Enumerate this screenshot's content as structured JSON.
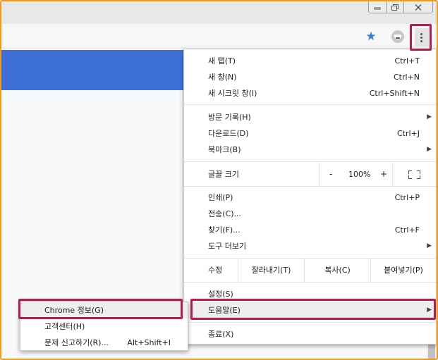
{
  "window": {
    "minimize_icon": "minimize-icon",
    "maximize_icon": "restore-icon",
    "close_icon": "close-icon"
  },
  "toolbar": {
    "bookmark_icon": "star-icon",
    "extension_icon": "extension-icon",
    "menu_icon": "kebab-menu-icon",
    "star_color": "#3b78e7"
  },
  "page": {
    "banner_color": "#3d6fd6"
  },
  "menu": {
    "new_tab": {
      "label": "새 탭(T)",
      "shortcut": "Ctrl+T"
    },
    "new_window": {
      "label": "새 창(N)",
      "shortcut": "Ctrl+N"
    },
    "incognito": {
      "label": "새 시크릿 창(I)",
      "shortcut": "Ctrl+Shift+N"
    },
    "history": {
      "label": "방문 기록(H)"
    },
    "downloads": {
      "label": "다운로드(D)",
      "shortcut": "Ctrl+J"
    },
    "bookmarks": {
      "label": "북마크(B)"
    },
    "zoom": {
      "label": "글꼴 크기",
      "minus": "-",
      "value": "100%",
      "plus": "+"
    },
    "print": {
      "label": "인쇄(P)",
      "shortcut": "Ctrl+P"
    },
    "cast": {
      "label": "전송(C)..."
    },
    "find": {
      "label": "찾기(F)...",
      "shortcut": "Ctrl+F"
    },
    "more_tools": {
      "label": "도구 더보기"
    },
    "edit": {
      "label": "수정",
      "cut": "잘라내기(T)",
      "copy": "복사(C)",
      "paste": "붙여넣기(P)"
    },
    "settings": {
      "label": "설정(S)"
    },
    "help": {
      "label": "도움말(E)"
    },
    "exit": {
      "label": "종료(X)"
    }
  },
  "help_submenu": {
    "about": {
      "label": "Chrome 정보(G)"
    },
    "help_center": {
      "label": "고객센터(H)"
    },
    "report": {
      "label": "문제 신고하기(R)...",
      "shortcut": "Alt+Shift+I"
    }
  },
  "highlight_color": "#b41c52"
}
